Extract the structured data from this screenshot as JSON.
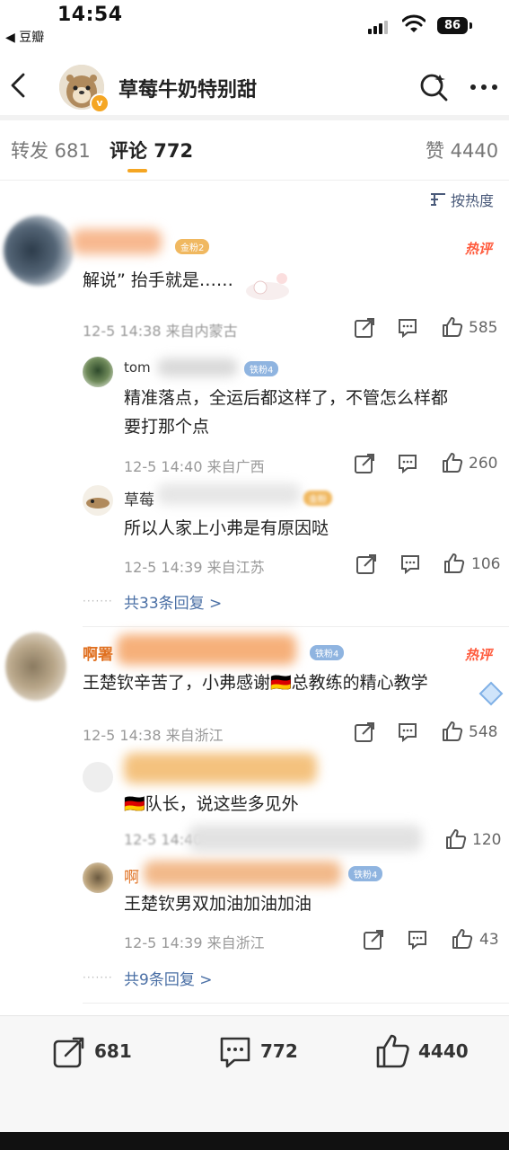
{
  "status_bar": {
    "time": "14:54",
    "back_app": "◀ 豆瓣",
    "battery": "86"
  },
  "header": {
    "title": "草莓牛奶特别甜"
  },
  "tabs": [
    {
      "label": "转发 681"
    },
    {
      "label": "评论 772"
    },
    {
      "label": "赞 4440"
    }
  ],
  "sort_label": "按热度",
  "comments": [
    {
      "badge": "金粉2",
      "hot_label": "热评",
      "text": "解说” 抬手就是……",
      "meta": "12-5 14:38  来自内蒙古",
      "likes": "585",
      "replies": [
        {
          "name": "tom",
          "badge": "铁粉4",
          "text_lines": [
            "精准落点，全运后都这样了，不管怎么样都",
            "要打那个点"
          ],
          "meta": "12-5 14:40  来自广西",
          "likes": "260"
        },
        {
          "name": "草莓",
          "badge": "金粉",
          "text_lines": [
            "所以人家上小弗是有原因哒"
          ],
          "meta": "12-5 14:39  来自江苏",
          "likes": "106"
        }
      ],
      "more_replies": "共33条回复 >"
    },
    {
      "name": "啊署",
      "badge": "铁粉4",
      "hot_label": "热评",
      "text": "王楚钦辛苦了，小弗感谢🇩🇪总教练的精心教学",
      "meta": "12-5 14:38  来自浙江",
      "likes": "548",
      "replies": [
        {
          "text_lines": [
            "🇩🇪队长，说这些多见外"
          ],
          "meta": "12-5 14:40",
          "likes": "120"
        },
        {
          "name": "啊",
          "badge": "铁粉4",
          "text_lines": [
            "王楚钦男双加油加油加油"
          ],
          "meta": "12-5 14:39  来自浙江",
          "likes": "43"
        }
      ],
      "more_replies": "共9条回复 >"
    }
  ],
  "bottom_bar": {
    "repost_count": "681",
    "comment_count": "772",
    "like_count": "4440"
  },
  "colors": {
    "accent": "#f5a623",
    "link": "#4a6fa5",
    "hot": "#ff5a3c"
  }
}
